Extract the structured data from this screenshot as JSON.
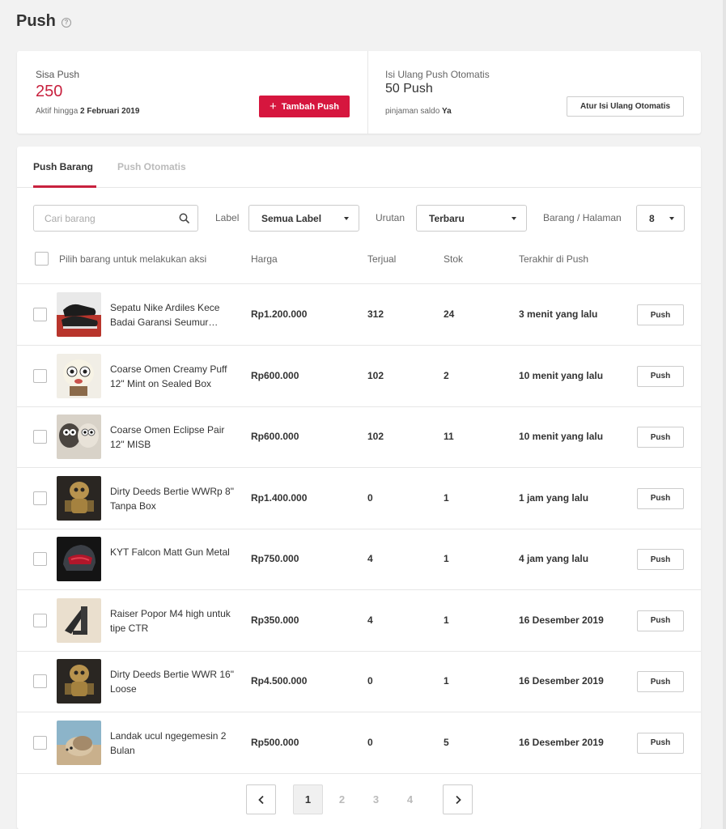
{
  "page": {
    "title": "Push",
    "help_icon": "question-circle-icon"
  },
  "summary": {
    "remaining_label": "Sisa Push",
    "remaining_value": "250",
    "active_until_prefix": "Aktif hingga",
    "active_until_date": "2 Februari 2019",
    "add_button_label": "Tambah Push",
    "auto_refill_label": "Isi Ulang Push Otomatis",
    "auto_refill_value": "50 Push",
    "loan_prefix": "pinjaman saldo",
    "loan_value": "Ya",
    "auto_refill_button_label": "Atur Isi Ulang Otomatis"
  },
  "tabs": [
    {
      "label": "Push Barang",
      "active": true
    },
    {
      "label": "Push Otomatis",
      "active": false
    }
  ],
  "filters": {
    "search_placeholder": "Cari barang",
    "label_caption": "Label",
    "label_value": "Semua Label",
    "sort_caption": "Urutan",
    "sort_value": "Terbaru",
    "per_page_caption": "Barang / Halaman",
    "per_page_value": "8"
  },
  "table": {
    "select_all_label": "Pilih barang untuk melakukan aksi",
    "columns": {
      "price": "Harga",
      "sold": "Terjual",
      "stock": "Stok",
      "last_push": "Terakhir di Push"
    },
    "push_button_label": "Push",
    "rows": [
      {
        "name": "Sepatu Nike Ardiles Kece Badai Garansi Seumur Hidup",
        "price": "Rp1.200.000",
        "sold": "312",
        "stock": "24",
        "last_push": "3 menit yang lalu",
        "thumb": "shoe"
      },
      {
        "name": "Coarse Omen Creamy Puff 12\" Mint on Sealed Box",
        "price": "Rp600.000",
        "sold": "102",
        "stock": "2",
        "last_push": "10 menit yang lalu",
        "thumb": "toy-white"
      },
      {
        "name": "Coarse Omen Eclipse Pair 12\" MISB",
        "price": "Rp600.000",
        "sold": "102",
        "stock": "11",
        "last_push": "10 menit yang lalu",
        "thumb": "toy-pair"
      },
      {
        "name": "Dirty Deeds Bertie WWRp 8\" Tanpa Box",
        "price": "Rp1.400.000",
        "sold": "0",
        "stock": "1",
        "last_push": "1 jam yang lalu",
        "thumb": "figure-gold"
      },
      {
        "name": "KYT Falcon Matt Gun Metal",
        "price": "Rp750.000",
        "sold": "4",
        "stock": "1",
        "last_push": "4 jam yang lalu",
        "thumb": "helmet"
      },
      {
        "name": "Raiser Popor M4 high untuk tipe CTR",
        "price": "Rp350.000",
        "sold": "4",
        "stock": "1",
        "last_push": "16 Desember 2019",
        "thumb": "stock-part"
      },
      {
        "name": "Dirty Deeds Bertie WWR 16\" Loose",
        "price": "Rp4.500.000",
        "sold": "0",
        "stock": "1",
        "last_push": "16 Desember 2019",
        "thumb": "figure-gold"
      },
      {
        "name": "Landak ucul ngegemesin 2 Bulan",
        "price": "Rp500.000",
        "sold": "0",
        "stock": "5",
        "last_push": "16 Desember 2019",
        "thumb": "hedgehog"
      }
    ]
  },
  "pagination": {
    "pages": [
      "1",
      "2",
      "3",
      "4"
    ],
    "current": "1",
    "prev_icon": "chevron-left-icon",
    "next_icon": "chevron-right-icon"
  },
  "colors": {
    "accent": "#d6163e",
    "value_red": "#c8213e"
  }
}
